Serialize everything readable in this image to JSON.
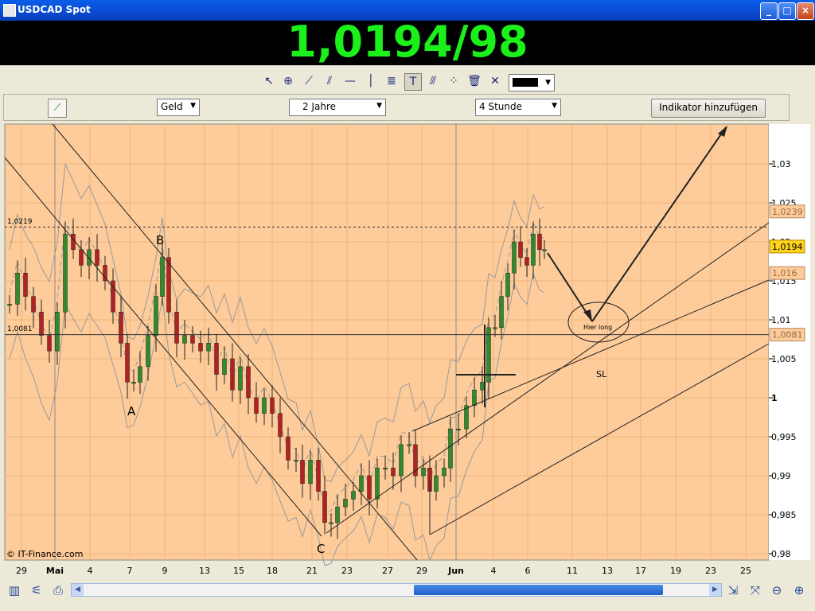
{
  "window": {
    "title": "USDCAD Spot",
    "minimize": "_",
    "maximize": "□",
    "close": "×"
  },
  "price": {
    "quote": "1,0194/98",
    "color": "#1bf01b"
  },
  "toolbar": {
    "tools": [
      "cursor-icon",
      "zoom-icon",
      "trendline-icon",
      "channel-icon",
      "horizontal-line-icon",
      "vertical-line-icon",
      "fibonacci-icon",
      "text-icon",
      "parallel-lines-icon",
      "points-icon",
      "delete-icon",
      "tools-icon"
    ],
    "line_color": "#000000"
  },
  "controls": {
    "price_type": "Geld",
    "period": "2 Jahre",
    "interval": "4 Stunde",
    "add_indicator": "Indikator hinzufügen"
  },
  "chart": {
    "background": "#fdcc9a",
    "up_color": "#2e8b2e",
    "down_color": "#b22222",
    "y_ticks": [
      "1,03",
      "1,025",
      "1,02",
      "1,015",
      "1,01",
      "1,005",
      "1",
      "0,995",
      "0,99",
      "0,985",
      "0,98"
    ],
    "y_tick_values": [
      1.03,
      1.025,
      1.02,
      1.015,
      1.01,
      1.005,
      1.0,
      0.995,
      0.99,
      0.985,
      0.98
    ],
    "x_labels": [
      "29",
      "Mai",
      "4",
      "7",
      "9",
      "13",
      "15",
      "18",
      "21",
      "23",
      "27",
      "29",
      "Jun",
      "4",
      "6",
      "11",
      "13",
      "17",
      "19",
      "23",
      "25"
    ],
    "price_labels": [
      {
        "text": "1,0239",
        "value": 1.0239,
        "style": "old"
      },
      {
        "text": "1,0194",
        "value": 1.0194,
        "style": "current"
      },
      {
        "text": "1,016",
        "value": 1.016,
        "style": "old"
      },
      {
        "text": "1,0081",
        "value": 1.0081,
        "style": "old"
      }
    ],
    "levels": [
      {
        "text": "1,0219",
        "value": 1.0219,
        "style": "dashed"
      },
      {
        "text": "1,0081",
        "value": 1.0081,
        "style": "solid"
      }
    ],
    "annotations": {
      "a": "A",
      "b": "B",
      "c": "C",
      "entry": "Hier long",
      "stop": "SL"
    },
    "watermark": "© IT-Finance.com"
  }
}
